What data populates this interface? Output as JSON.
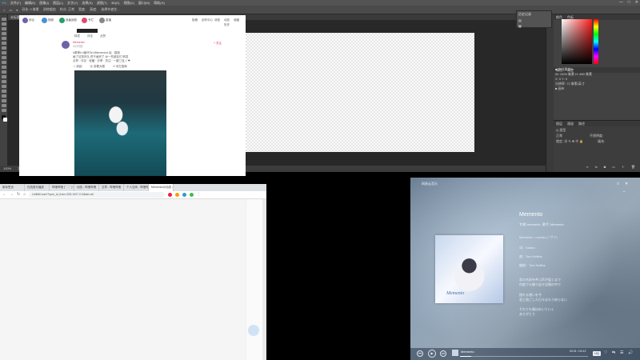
{
  "photoshop": {
    "menu": [
      "文件(F)",
      "编辑(E)",
      "图像(I)",
      "图层(L)",
      "文字(Y)",
      "选择(S)",
      "滤镜(T)",
      "3D(D)",
      "视图(V)",
      "窗口(W)",
      "帮助(H)"
    ],
    "window_controls": [
      "—",
      "□",
      "✕"
    ],
    "options": [
      "⌂",
      "▭",
      "▾",
      "羽化: 0 像素",
      "消除锯齿",
      "样式: 正常",
      "宽度:",
      "高度:",
      "选择并遮住..."
    ],
    "doc_tab": "未标题-1 @ 100% (RGB/8) ×",
    "status_zoom": "100%",
    "status_doc": "文档:2.64M/0字节",
    "history_panel": [
      "历史记录",
      "▤",
      "▦"
    ],
    "right_tabs": [
      "颜色",
      "色板"
    ],
    "props_tabs": [
      "属性",
      "调整"
    ],
    "props_lines": [
      "■ 文档属性",
      "",
      "W: 1920 像素   H: 480 像素",
      "X: 0   Y: 0",
      "分辨率: 72 像素/英寸",
      "",
      "■ 画布"
    ],
    "layers_tabs": [
      "图层",
      "通道",
      "路径"
    ],
    "layers_filter": "Q 类型",
    "layers_blend": "正常",
    "layers_opacity": "不透明度:",
    "layers_lock": "锁定: ▦ ✎ ✥ ▣ 🔒",
    "layers_fill": "填充:"
  },
  "browser": {
    "tabs": [
      "新标签页",
      "在线音乐播放",
      "哔哩哔哩 (゜-゜)つ",
      "动态 - 哔哩哔哩",
      "文章 - 哔哩哔哩",
      "个人空间 - 哔哩哔哩",
      "Mementoの动态 - 哔哩"
    ],
    "url": "t.bilibili.com/?spm_id_from=333.1007.0.0&tab=all",
    "page": {
      "follows": [
        "综合",
        "视频",
        "追番追剧",
        "专栏",
        "直播"
      ],
      "header_right": [
        "投稿",
        "创作中心",
        "消息",
        "动态",
        "收藏",
        "历史"
      ],
      "post_user": "Memento",
      "post_time": "3小时前",
      "post_lines": [
        "#原神# #崩坏3# #Memento# 绘 · 感谢",
        "画了这张好久 终于画完了 @一些朋友们 转发",
        "点赞 · 评论 · 收藏 · 分享 · 关注 · 一键三连 ✓ ❤"
      ],
      "follow_btn": "+ 关注",
      "actions": [
        "转发",
        "评论",
        "点赞"
      ]
    }
  },
  "music": {
    "app_title": "网易云音乐",
    "song_title": "Memento",
    "album_label": "专辑：",
    "album": "memento",
    "artist_label": "歌手：",
    "artist": "Memento",
    "cover_text": "Memento",
    "lyrics": [
      "Memento - nuvola (ノヴァ)",
      "",
      "词：Kotaro",
      "曲：Tom Hollins",
      "编曲：Tom Hollins",
      "",
      "君の名前を呼ぶ声が届くまで",
      "何度でも繰り返す記憶の中で",
      "",
      "揺れる想いを今",
      "",
      "君と過ごした日々はもう戻らない",
      "それでも僕は歩いていく",
      "",
      "ありがとう"
    ],
    "hq": "HQ",
    "controls": [
      "⏮",
      "▶",
      "⏭"
    ],
    "now_playing": "Memento",
    "time": "00:31 / 04:12",
    "icons": [
      "♡",
      "⇆",
      "☰",
      "🔊"
    ]
  }
}
